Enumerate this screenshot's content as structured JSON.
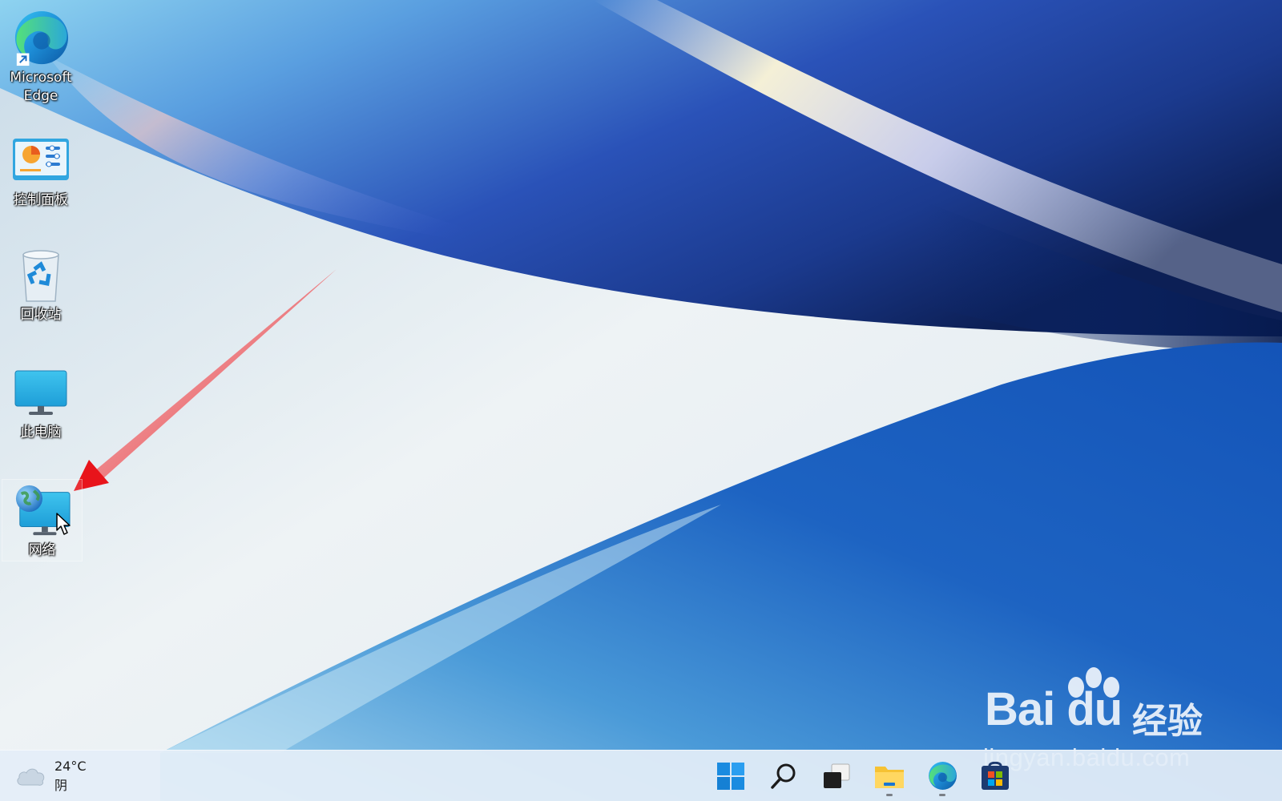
{
  "desktop": {
    "icons": [
      {
        "label": "Microsoft Edge",
        "icon": "edge-icon"
      },
      {
        "label": "控制面板",
        "icon": "control-panel-icon"
      },
      {
        "label": "回收站",
        "icon": "recycle-bin-icon"
      },
      {
        "label": "此电脑",
        "icon": "this-pc-icon"
      },
      {
        "label": "网络",
        "icon": "network-icon"
      }
    ],
    "selected_icon": "网络"
  },
  "watermark": {
    "brand": "Bai du",
    "brand_cn": "经验",
    "url": "jingyan.baidu.com"
  },
  "taskbar": {
    "weather": {
      "temperature": "24°C",
      "condition": "阴",
      "icon": "cloud-icon"
    },
    "apps": [
      {
        "name": "start",
        "icon": "windows-start-icon",
        "running": false
      },
      {
        "name": "search",
        "icon": "search-icon",
        "running": false
      },
      {
        "name": "task-view",
        "icon": "task-view-icon",
        "running": false
      },
      {
        "name": "file-explorer",
        "icon": "folder-icon",
        "running": true
      },
      {
        "name": "edge",
        "icon": "edge-icon",
        "running": true
      },
      {
        "name": "store",
        "icon": "store-icon",
        "running": false
      }
    ]
  },
  "annotation": {
    "arrow_color": "#e8141b",
    "points_to": "网络"
  },
  "colors": {
    "accent_blue": "#1560c4",
    "taskbar_bg": "#e4eef7"
  }
}
